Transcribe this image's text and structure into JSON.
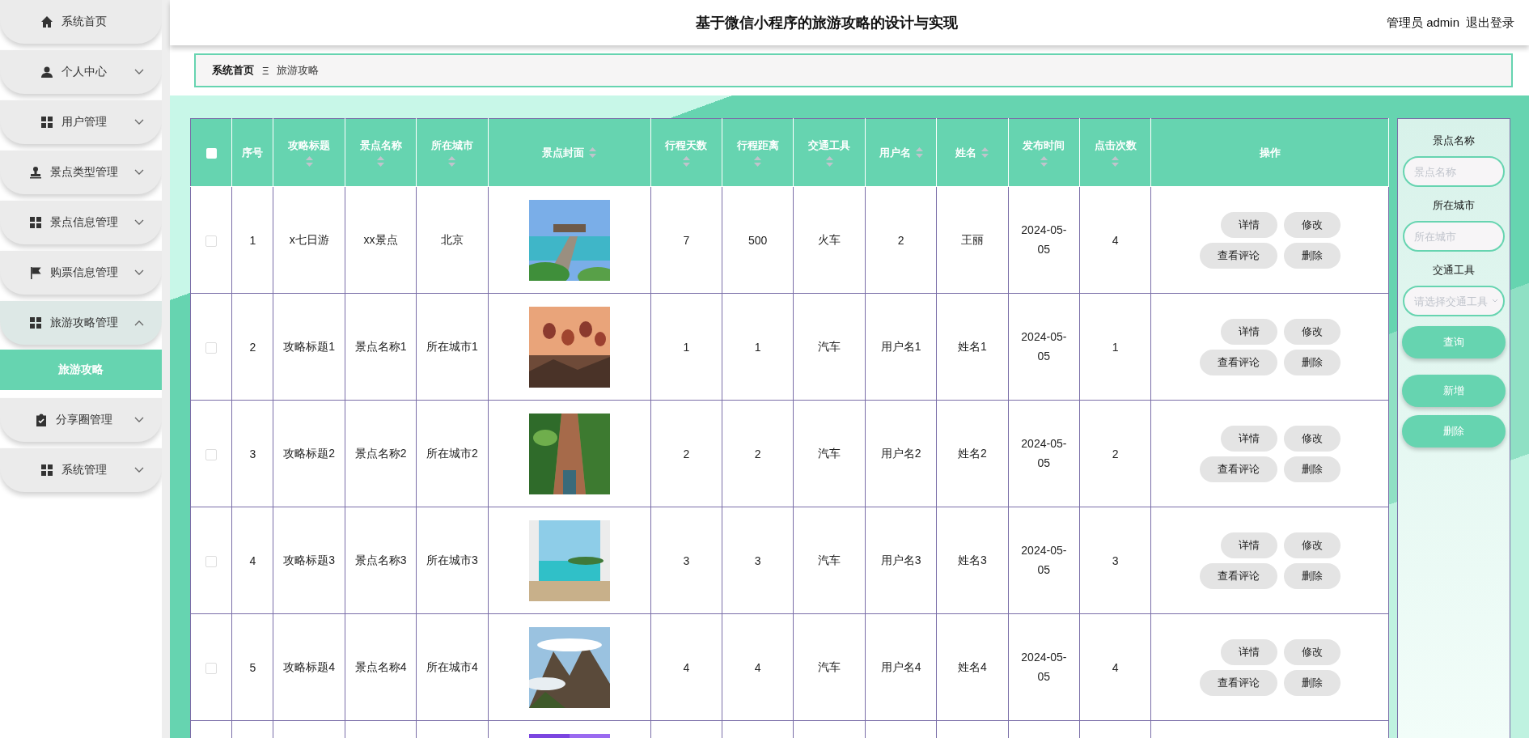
{
  "sidebar": {
    "items": [
      {
        "label": "系统首页"
      },
      {
        "label": "个人中心",
        "expanded": false
      },
      {
        "label": "用户管理",
        "expanded": false
      },
      {
        "label": "景点类型管理",
        "expanded": false
      },
      {
        "label": "景点信息管理",
        "expanded": false
      },
      {
        "label": "购票信息管理",
        "expanded": false
      },
      {
        "label": "旅游攻略管理",
        "expanded": true,
        "children": [
          {
            "label": "旅游攻略",
            "selected": true
          }
        ]
      },
      {
        "label": "分享圈管理",
        "expanded": false
      },
      {
        "label": "系统管理",
        "expanded": false
      }
    ]
  },
  "header": {
    "title": "基于微信小程序的旅游攻略的设计与实现",
    "user": "管理员 admin",
    "logout": "退出登录"
  },
  "breadcrumb": [
    "系统首页",
    "Ξ",
    "旅游攻略"
  ],
  "table": {
    "select_all": {
      "checked": false
    },
    "columns": [
      {
        "label": "序号",
        "sortable": false
      },
      {
        "label": "攻略标题",
        "sortable": true
      },
      {
        "label": "景点名称",
        "sortable": true
      },
      {
        "label": "所在城市",
        "sortable": true
      },
      {
        "label": "景点封面",
        "sortable": true
      },
      {
        "label": "行程天数",
        "sortable": true
      },
      {
        "label": "行程距离",
        "sortable": true
      },
      {
        "label": "交通工具",
        "sortable": true
      },
      {
        "label": "用户名",
        "sortable": true
      },
      {
        "label": "姓名",
        "sortable": true
      },
      {
        "label": "发布时间",
        "sortable": true
      },
      {
        "label": "点击次数",
        "sortable": true
      },
      {
        "label": "操作",
        "sortable": false
      }
    ],
    "rows": [
      {
        "checked": false,
        "cells": [
          "1",
          "x七日游",
          "xx景点",
          "北京",
          {
            "kind": "picture"
          },
          "7",
          "500",
          "火车",
          "2",
          "王丽",
          "2024-05-05",
          "4"
        ],
        "actions": [
          "详情",
          "修改",
          "查看评论",
          "删除"
        ]
      },
      {
        "checked": false,
        "cells": [
          "2",
          "攻略标题1",
          "景点名称1",
          "所在城市1",
          {
            "kind": "picture"
          },
          "1",
          "1",
          "汽车",
          "用户名1",
          "姓名1",
          "2024-05-05",
          "1"
        ],
        "actions": [
          "详情",
          "修改",
          "查看评论",
          "删除"
        ]
      },
      {
        "checked": false,
        "cells": [
          "3",
          "攻略标题2",
          "景点名称2",
          "所在城市2",
          {
            "kind": "picture"
          },
          "2",
          "2",
          "汽车",
          "用户名2",
          "姓名2",
          "2024-05-05",
          "2"
        ],
        "actions": [
          "详情",
          "修改",
          "查看评论",
          "删除"
        ]
      },
      {
        "checked": false,
        "cells": [
          "4",
          "攻略标题3",
          "景点名称3",
          "所在城市3",
          {
            "kind": "picture"
          },
          "3",
          "3",
          "汽车",
          "用户名3",
          "姓名3",
          "2024-05-05",
          "3"
        ],
        "actions": [
          "详情",
          "修改",
          "查看评论",
          "删除"
        ]
      },
      {
        "checked": false,
        "cells": [
          "5",
          "攻略标题4",
          "景点名称4",
          "所在城市4",
          {
            "kind": "picture"
          },
          "4",
          "4",
          "汽车",
          "用户名4",
          "姓名4",
          "2024-05-05",
          "4"
        ],
        "actions": [
          "详情",
          "修改",
          "查看评论",
          "删除"
        ]
      },
      {
        "cells": [
          "",
          "",
          "",
          "",
          {
            "kind": "picture"
          }
        ]
      }
    ]
  },
  "search": {
    "fields": [
      {
        "label": "景点名称",
        "kind": "text",
        "placeholder": "景点名称"
      },
      {
        "label": "所在城市",
        "kind": "text",
        "placeholder": "所在城市"
      },
      {
        "label": "交通工具",
        "kind": "select",
        "placeholder": "请选择交通工具"
      }
    ],
    "buttons": [
      "查询",
      "新增",
      "删除"
    ]
  }
}
